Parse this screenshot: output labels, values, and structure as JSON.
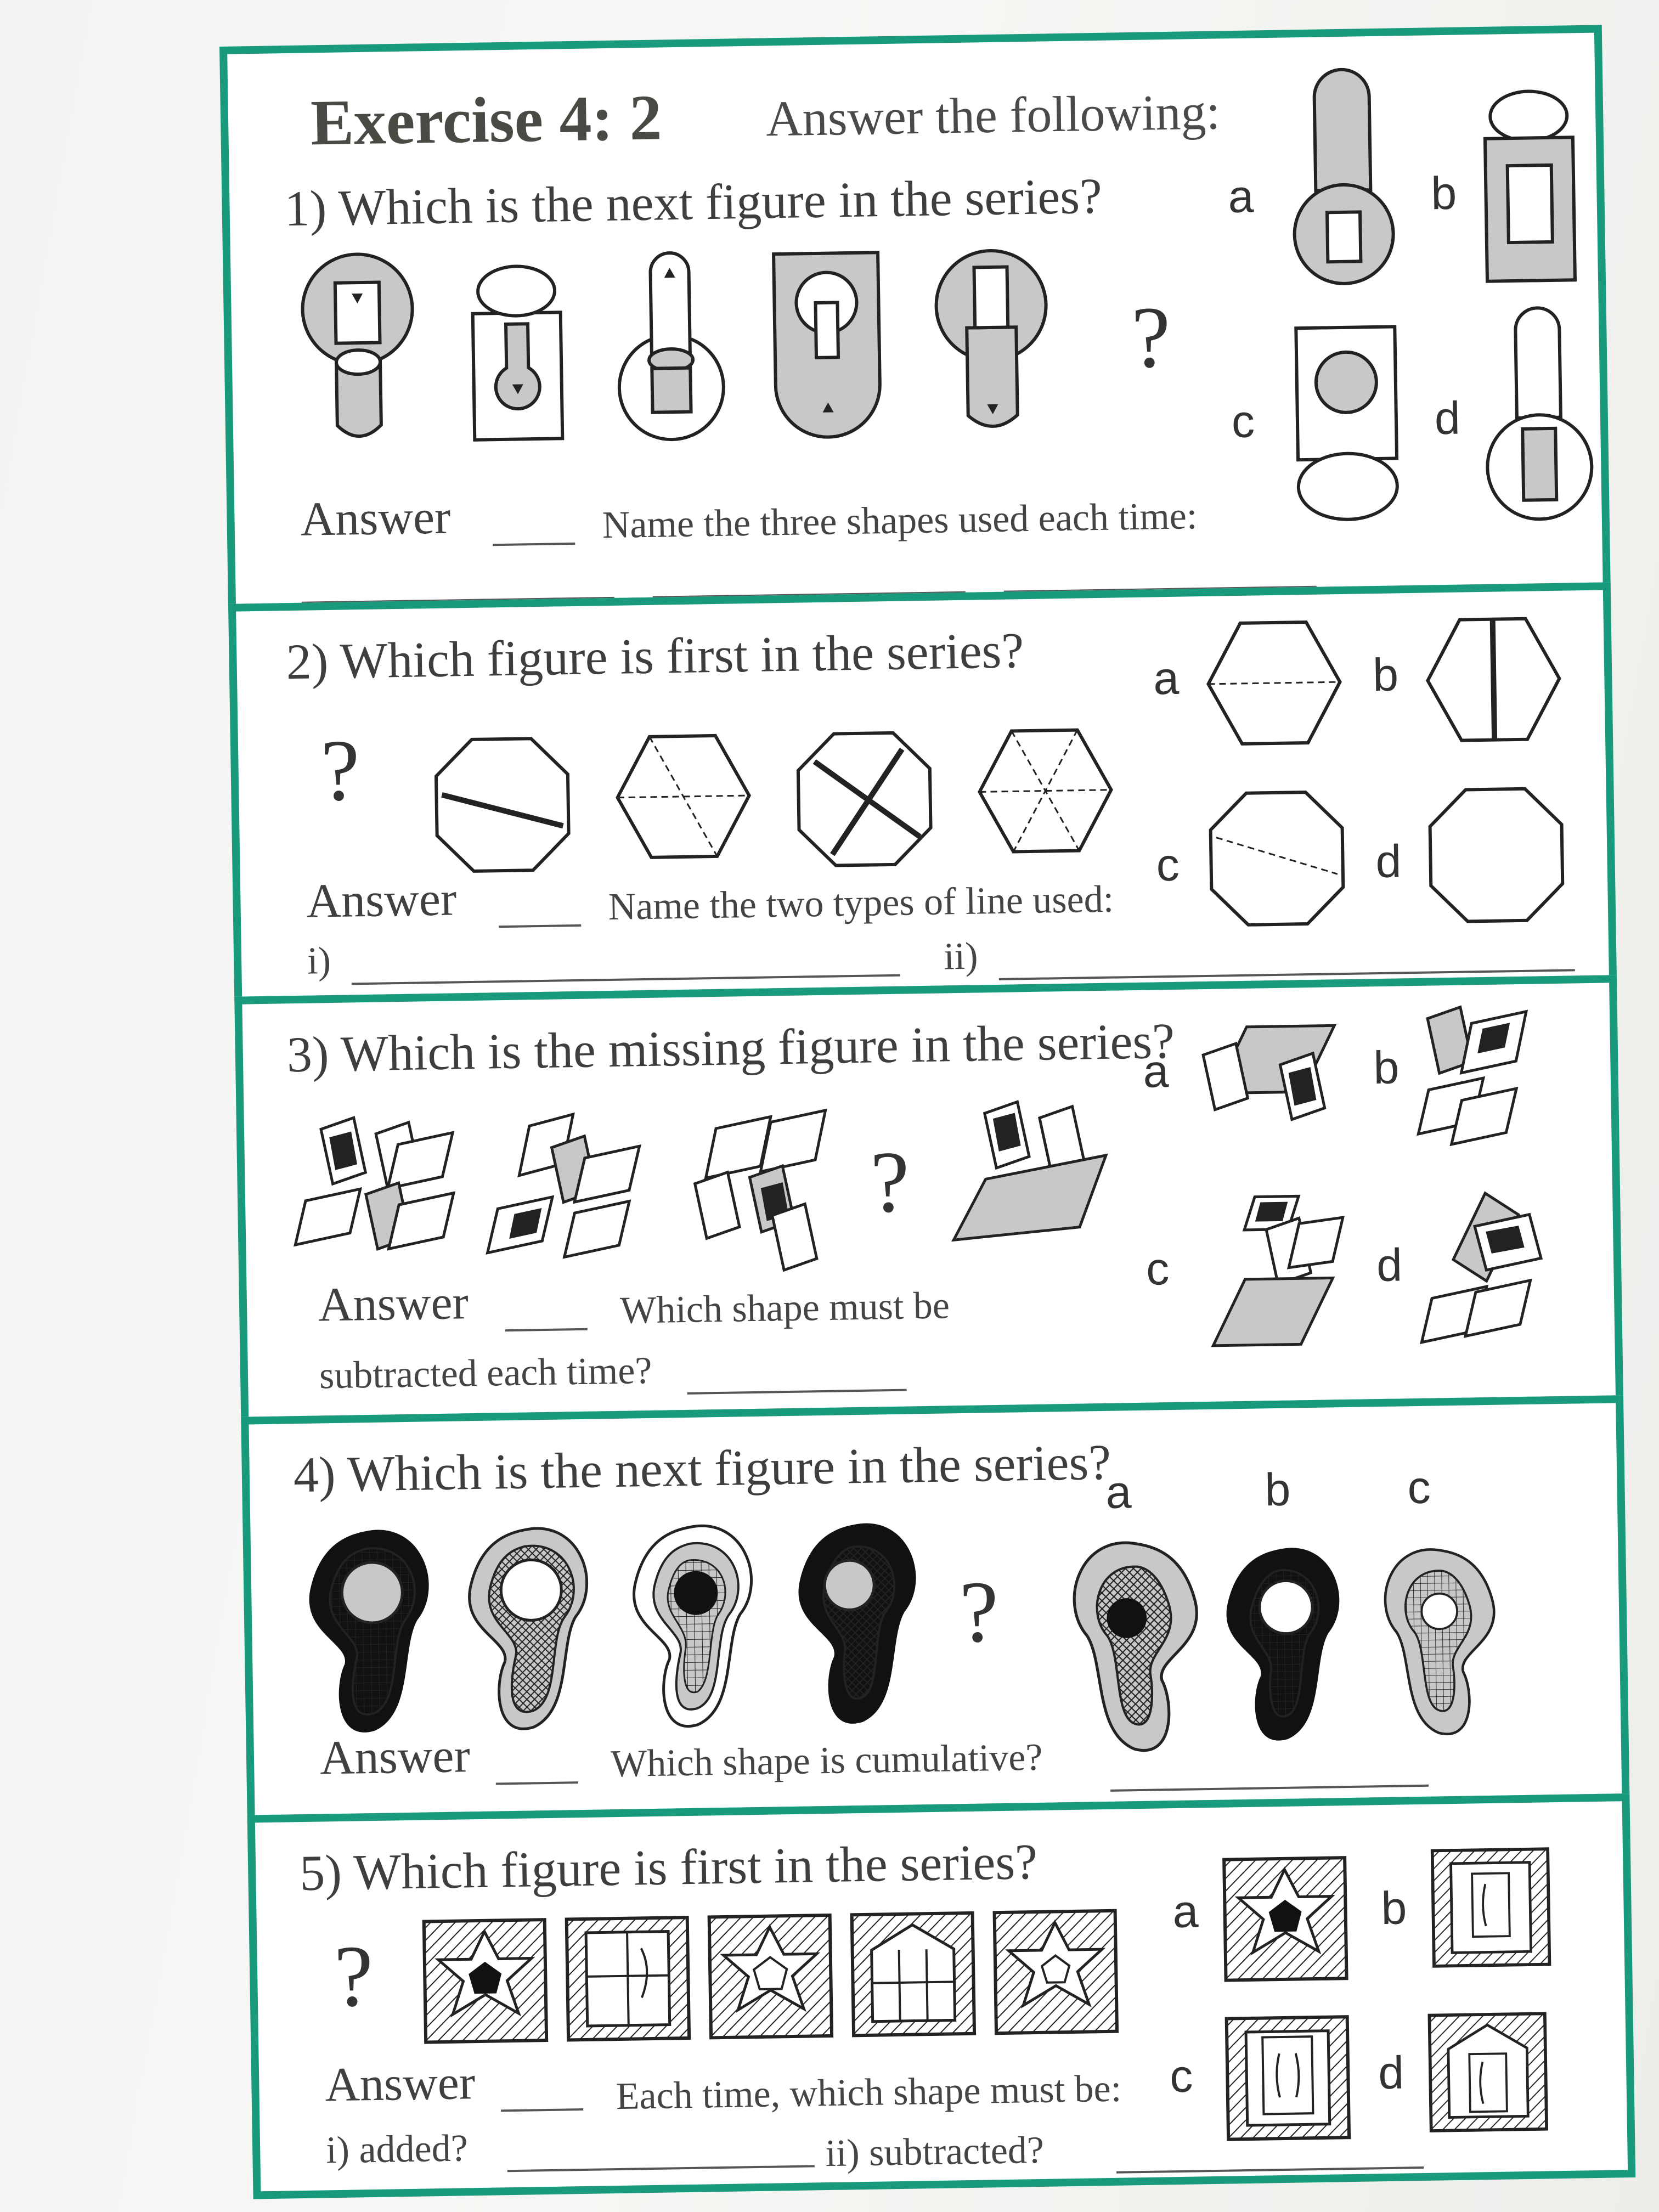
{
  "header": {
    "title": "Exercise 4: 2",
    "subtitle": "Answer the following:"
  },
  "q1": {
    "question": "1) Which is the next figure in the series?",
    "answer_label": "Answer",
    "prompt": "Name the three shapes used each time:",
    "option_labels": [
      "a",
      "b",
      "c",
      "d"
    ],
    "missing": "?"
  },
  "q2": {
    "question": "2) Which figure is first in the series?",
    "answer_label": "Answer",
    "prompt": "Name the two types of line used:",
    "sub_i": "i)",
    "sub_ii": "ii)",
    "option_labels": [
      "a",
      "b",
      "c",
      "d"
    ],
    "missing": "?"
  },
  "q3": {
    "question": "3) Which is the missing figure in the series?",
    "answer_label": "Answer",
    "prompt_line1": "Which shape must be",
    "prompt_line2": "subtracted each time?",
    "option_labels": [
      "a",
      "b",
      "c",
      "d"
    ],
    "missing": "?"
  },
  "q4": {
    "question": "4) Which is the next figure in the series?",
    "answer_label": "Answer",
    "prompt": "Which shape is cumulative?",
    "option_labels": [
      "a",
      "b",
      "c"
    ],
    "missing": "?"
  },
  "q5": {
    "question": "5) Which figure is first in the series?",
    "answer_label": "Answer",
    "prompt": "Each time, which shape must be:",
    "sub_i": "i) added?",
    "sub_ii": "ii) subtracted?",
    "option_labels": [
      "a",
      "b",
      "c",
      "d"
    ],
    "missing": "?"
  },
  "colors": {
    "border": "#1a9a7c",
    "grey_fill": "#c8c8c8",
    "ink": "#222222"
  }
}
